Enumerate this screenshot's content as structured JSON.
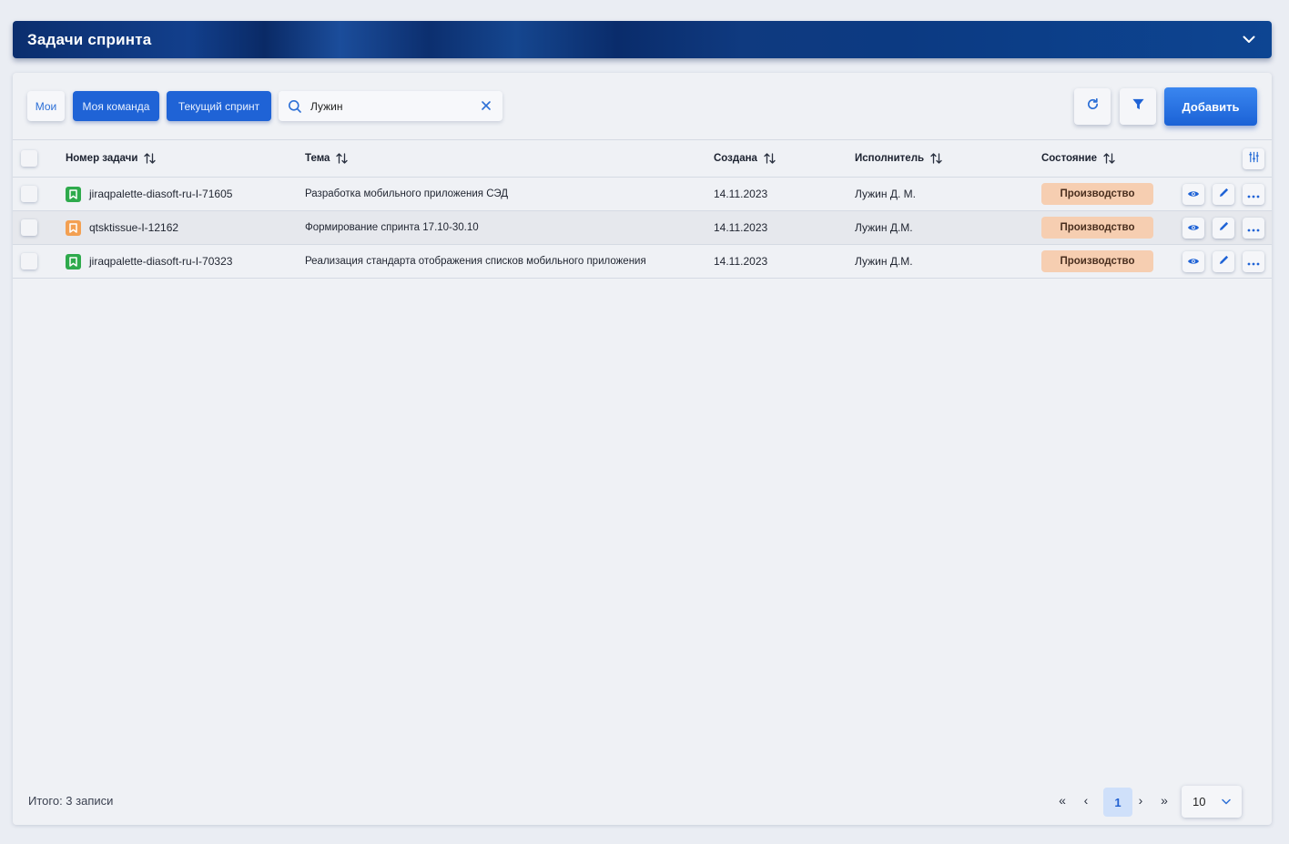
{
  "header": {
    "title": "Задачи спринта"
  },
  "toolbar": {
    "filters": [
      {
        "label": "Мои",
        "active": false
      },
      {
        "label": "Моя команда",
        "active": true
      },
      {
        "label": "Текущий спринт",
        "active": true
      }
    ],
    "search": {
      "value": "Лужин",
      "placeholder": ""
    },
    "add_label": "Добавить"
  },
  "table": {
    "columns": [
      "Номер задачи",
      "Тема",
      "Создана",
      "Исполнитель",
      "Состояние"
    ],
    "rows": [
      {
        "key": "jiraqpalette-diasoft-ru-I-71605",
        "icon": "bookmark-icon",
        "icon_color": "#2eaa4c",
        "subject": "Разработка мобильного приложения СЭД",
        "created": "14.11.2023",
        "assignee": "Лужин Д. М.",
        "status": "Производство"
      },
      {
        "key": "qtsktissue-I-12162",
        "icon": "bookmark-icon",
        "icon_color": "#f3a052",
        "subject": "Формирование спринта 17.10-30.10",
        "created": "14.11.2023",
        "assignee": "Лужин Д.М.",
        "status": "Производство"
      },
      {
        "key": "jiraqpalette-diasoft-ru-I-70323",
        "icon": "bookmark-icon",
        "icon_color": "#2eaa4c",
        "subject": "Реализация стандарта отображения списков мобильного приложения",
        "created": "14.11.2023",
        "assignee": "Лужин Д.М.",
        "status": "Производство"
      }
    ]
  },
  "footer": {
    "total": "Итого: 3 записи",
    "first": "«",
    "prev": "‹",
    "current_page": "1",
    "next": "›",
    "last": "»",
    "page_size": "10"
  },
  "colors": {
    "accent": "#1f63d6",
    "header": "#0b2e6e",
    "status_bg": "#f6ceb1"
  }
}
